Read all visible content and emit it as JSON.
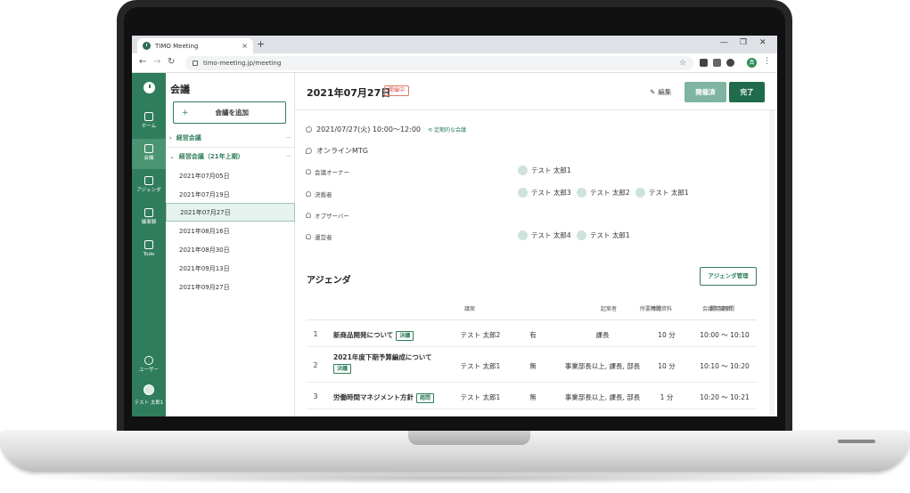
{
  "browser": {
    "tab_title": "TIMO Meeting",
    "url": "timo-meeting.jp/meeting",
    "profile_initial": "真"
  },
  "rail": {
    "items": [
      {
        "label": "ホーム",
        "icon": "home-icon"
      },
      {
        "label": "会議",
        "icon": "meeting-icon"
      },
      {
        "label": "アジェンダ",
        "icon": "document-icon"
      },
      {
        "label": "議事録",
        "icon": "clipboard-icon"
      },
      {
        "label": "Todo",
        "icon": "checkbox-icon"
      }
    ],
    "users_label": "ユーザー",
    "user_name": "テスト 太郎1",
    "accent": "#2f7d5c"
  },
  "sidebar": {
    "title": "会議",
    "add_button": "会議を追加",
    "folders": [
      {
        "label": "経営会議"
      },
      {
        "label": "経営会議（21年上期）"
      }
    ],
    "meetings": [
      "2021年07月05日",
      "2021年07月19日",
      "2021年07月27日",
      "2021年08月16日",
      "2021年08月30日",
      "2021年09月13日",
      "2021年09月27日"
    ],
    "selected": "2021年07月27日"
  },
  "main": {
    "date": "2021年07月27日",
    "status": "開催中",
    "edit": "編集",
    "btn_held": "開催済",
    "btn_finish": "完了",
    "time": "2021/07/27(火)  10:00〜12:00",
    "repeat": "定期的な会議",
    "location": "オンラインMTG",
    "roles": {
      "owner_label": "会議オーナー",
      "owner": [
        "テスト 太郎1"
      ],
      "decider_label": "決裁者",
      "deciders": [
        "テスト 太郎3",
        "テスト 太郎2",
        "テスト 太郎1"
      ],
      "observer_label": "オブザーバー",
      "operator_label": "運営者",
      "operators": [
        "テスト 太郎4",
        "テスト 太郎1"
      ]
    },
    "agenda_title": "アジェンダ",
    "agenda_manage": "アジェンダ管理",
    "columns": [
      "議案",
      "起案者",
      "添付資料",
      "開示範囲",
      "所要時間",
      "会議参加時間"
    ],
    "rows": [
      {
        "no": "1",
        "title": "新商品開発について",
        "tag": "決議",
        "author": "テスト 太郎2",
        "attach": "有",
        "scope": "課長",
        "duration": "10 分",
        "time": "10:00 〜 10:10"
      },
      {
        "no": "2",
        "title": "2021年度下期予算編成について",
        "tag": "決議",
        "author": "テスト 太郎1",
        "attach": "無",
        "scope": "事業部長以上, 課長, 部長",
        "duration": "10 分",
        "time": "10:10 〜 10:20"
      },
      {
        "no": "3",
        "title": "労働時間マネジメント方針",
        "tag": "諮問",
        "author": "テスト 太郎1",
        "attach": "無",
        "scope": "事業部長以上, 課長, 部長",
        "duration": "1 分",
        "time": "10:20 〜 10:21"
      }
    ]
  }
}
